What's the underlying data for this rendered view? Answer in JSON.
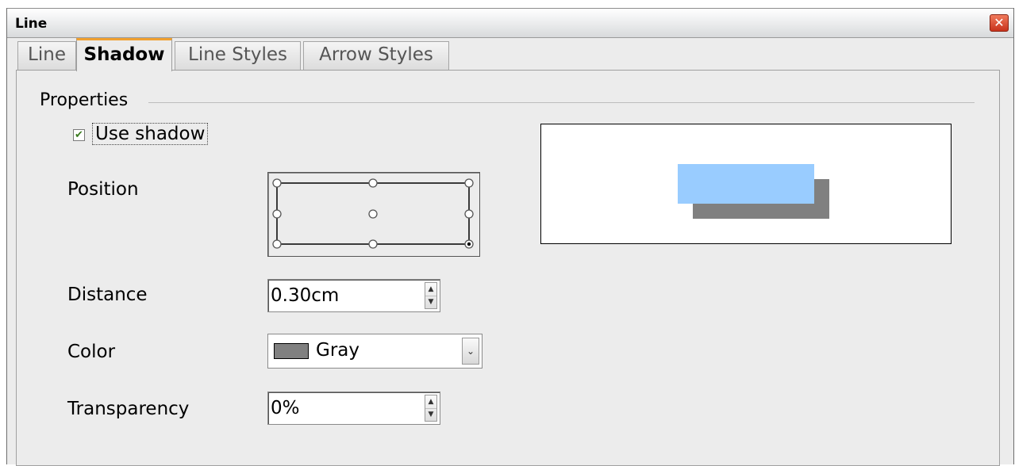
{
  "window": {
    "title": "Line",
    "close_glyph": "✕"
  },
  "tabs": [
    {
      "label": "Line",
      "active": false
    },
    {
      "label": "Shadow",
      "active": true
    },
    {
      "label": "Line Styles",
      "active": false
    },
    {
      "label": "Arrow Styles",
      "active": false
    }
  ],
  "properties": {
    "group_label": "Properties",
    "use_shadow": {
      "label": "Use shadow",
      "checked": true,
      "check_glyph": "✔"
    },
    "position": {
      "label": "Position",
      "selected": "bottom-right"
    },
    "distance": {
      "label": "Distance",
      "value": "0.30cm"
    },
    "color": {
      "label": "Color",
      "value": "Gray",
      "swatch": "#808080"
    },
    "transparency": {
      "label": "Transparency",
      "value": "0%"
    }
  },
  "preview": {
    "object_color": "#99ccff",
    "shadow_color": "#808080"
  },
  "icons": {
    "close": "close-icon",
    "spin_up": "▲",
    "spin_down": "▼",
    "dropdown": "chevron-down-icon",
    "dropdown_glyph": "⌄"
  }
}
